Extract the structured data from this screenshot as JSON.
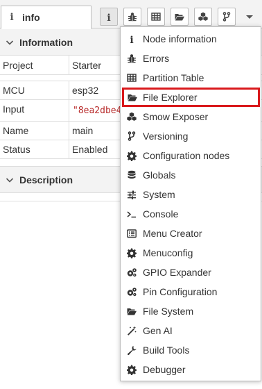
{
  "tab": {
    "label": "info",
    "icon": "info-icon"
  },
  "toolbar": {
    "buttons": [
      {
        "name": "info-button",
        "icon": "info-icon"
      },
      {
        "name": "errors-button",
        "icon": "bug-icon"
      },
      {
        "name": "partition-table-button",
        "icon": "table-icon"
      },
      {
        "name": "file-explorer-button",
        "icon": "folder-open-icon"
      },
      {
        "name": "smow-exposer-button",
        "icon": "cubes-icon"
      },
      {
        "name": "versioning-button",
        "icon": "code-fork-icon"
      },
      {
        "name": "more-menu-button",
        "icon": "caret-down-icon"
      }
    ]
  },
  "info_panel": {
    "information_title": "Information",
    "rows": [
      {
        "key": "Project",
        "value": "Starter"
      },
      {
        "key": "MCU",
        "value": "esp32"
      },
      {
        "key": "Input",
        "value": "\"8ea2dbe4"
      },
      {
        "key": "Name",
        "value": "main"
      },
      {
        "key": "Status",
        "value": "Enabled"
      }
    ],
    "description_title": "Description"
  },
  "menu": {
    "highlighted_index": 3,
    "highlight_color": "#d9191c",
    "items": [
      {
        "label": "Node information",
        "icon": "info-icon"
      },
      {
        "label": "Errors",
        "icon": "bug-icon"
      },
      {
        "label": "Partition Table",
        "icon": "table-icon"
      },
      {
        "label": "File Explorer",
        "icon": "folder-open-icon"
      },
      {
        "label": "Smow Exposer",
        "icon": "cubes-icon"
      },
      {
        "label": "Versioning",
        "icon": "code-fork-icon"
      },
      {
        "label": "Configuration nodes",
        "icon": "gear-icon"
      },
      {
        "label": "Globals",
        "icon": "database-icon"
      },
      {
        "label": "System",
        "icon": "sliders-icon"
      },
      {
        "label": "Console",
        "icon": "terminal-icon"
      },
      {
        "label": "Menu Creator",
        "icon": "list-alt-icon"
      },
      {
        "label": "Menuconfig",
        "icon": "gear-icon"
      },
      {
        "label": "GPIO Expander",
        "icon": "gears-icon"
      },
      {
        "label": "Pin Configuration",
        "icon": "gears-icon"
      },
      {
        "label": "File System",
        "icon": "folder-open-icon"
      },
      {
        "label": "Gen AI",
        "icon": "magic-icon"
      },
      {
        "label": "Build Tools",
        "icon": "wrench-icon"
      },
      {
        "label": "Debugger",
        "icon": "gear-icon"
      }
    ]
  }
}
